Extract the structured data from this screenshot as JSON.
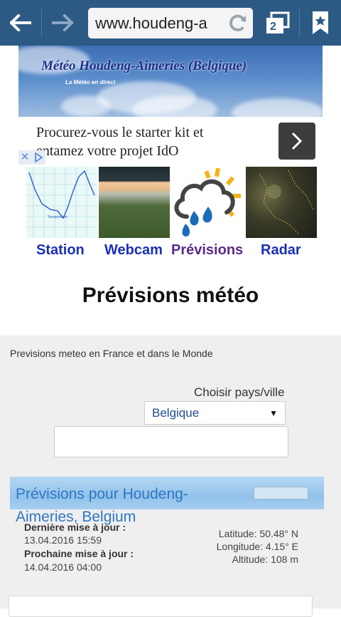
{
  "browser": {
    "url": "www.houdeng-a",
    "tab_count": "2",
    "icons": [
      "back-arrow-icon",
      "forward-arrow-icon",
      "reload-icon",
      "tabs-icon",
      "bookmark-star-icon"
    ]
  },
  "banner": {
    "title": "Météo Houdeng-Aimeries (Belgique)",
    "subtitle": "La Météo en direct"
  },
  "ad": {
    "text": "Procurez-vous le starter kit et entamez votre projet IdO"
  },
  "nav": [
    {
      "label": "Station",
      "icon": "station-graph-thumbnail"
    },
    {
      "label": "Webcam",
      "icon": "webcam-thumbnail"
    },
    {
      "label": "Prévisions",
      "icon": "forecast-cloud-thumbnail"
    },
    {
      "label": "Radar",
      "icon": "radar-thumbnail"
    }
  ],
  "page_title": "Prévisions météo",
  "widget": {
    "intro": "Previsions meteo en France et dans le Monde",
    "choose_label": "Choisir pays/ville",
    "country_selected": "Belgique",
    "city_value": "",
    "forecast_title": "Prévisions pour Houdeng-Aimeries, Belgium",
    "last_update_label": "Dernière mise à jour :",
    "last_update_value": "13.04.2016 15:59",
    "next_update_label": "Prochaine mise à jour :",
    "next_update_value": "14.04.2016 04:00",
    "latitude": "Latitude: 50.48° N",
    "longitude": "Longitude: 4.15° E",
    "altitude": "Altitude: 108 m"
  },
  "colors": {
    "toolbar": "#2d5a84",
    "nav_link": "#1a2fb5",
    "nav_active": "#5a2a8a",
    "forecast_title": "#2d77c4"
  }
}
